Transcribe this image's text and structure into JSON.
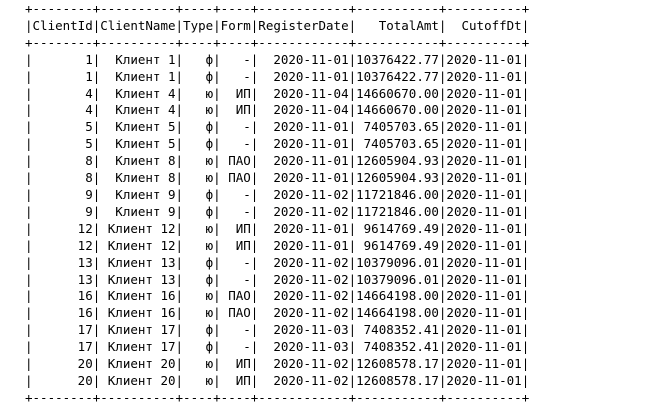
{
  "border": "+--------+----------+----+----+------------+-----------+----------+",
  "header": "|ClientId|ClientName|Type|Form|RegisterDate|   TotalAmt|  CutoffDt|",
  "rows": [
    "|       1|  Клиент 1|   ф|   -|  2020-11-01|10376422.77|2020-11-01|",
    "|       1|  Клиент 1|   ф|   -|  2020-11-01|10376422.77|2020-11-01|",
    "|       4|  Клиент 4|   ю|  ИП|  2020-11-04|14660670.00|2020-11-01|",
    "|       4|  Клиент 4|   ю|  ИП|  2020-11-04|14660670.00|2020-11-01|",
    "|       5|  Клиент 5|   ф|   -|  2020-11-01| 7405703.65|2020-11-01|",
    "|       5|  Клиент 5|   ф|   -|  2020-11-01| 7405703.65|2020-11-01|",
    "|       8|  Клиент 8|   ю| ПАО|  2020-11-01|12605904.93|2020-11-01|",
    "|       8|  Клиент 8|   ю| ПАО|  2020-11-01|12605904.93|2020-11-01|",
    "|       9|  Клиент 9|   ф|   -|  2020-11-02|11721846.00|2020-11-01|",
    "|       9|  Клиент 9|   ф|   -|  2020-11-02|11721846.00|2020-11-01|",
    "|      12| Клиент 12|   ю|  ИП|  2020-11-01| 9614769.49|2020-11-01|",
    "|      12| Клиент 12|   ю|  ИП|  2020-11-01| 9614769.49|2020-11-01|",
    "|      13| Клиент 13|   ф|   -|  2020-11-02|10379096.01|2020-11-01|",
    "|      13| Клиент 13|   ф|   -|  2020-11-02|10379096.01|2020-11-01|",
    "|      16| Клиент 16|   ю| ПАО|  2020-11-02|14664198.00|2020-11-01|",
    "|      16| Клиент 16|   ю| ПАО|  2020-11-02|14664198.00|2020-11-01|",
    "|      17| Клиент 17|   ф|   -|  2020-11-03| 7408352.41|2020-11-01|",
    "|      17| Клиент 17|   ф|   -|  2020-11-03| 7408352.41|2020-11-01|",
    "|      20| Клиент 20|   ю|  ИП|  2020-11-02|12608578.17|2020-11-01|",
    "|      20| Клиент 20|   ю|  ИП|  2020-11-02|12608578.17|2020-11-01|"
  ]
}
